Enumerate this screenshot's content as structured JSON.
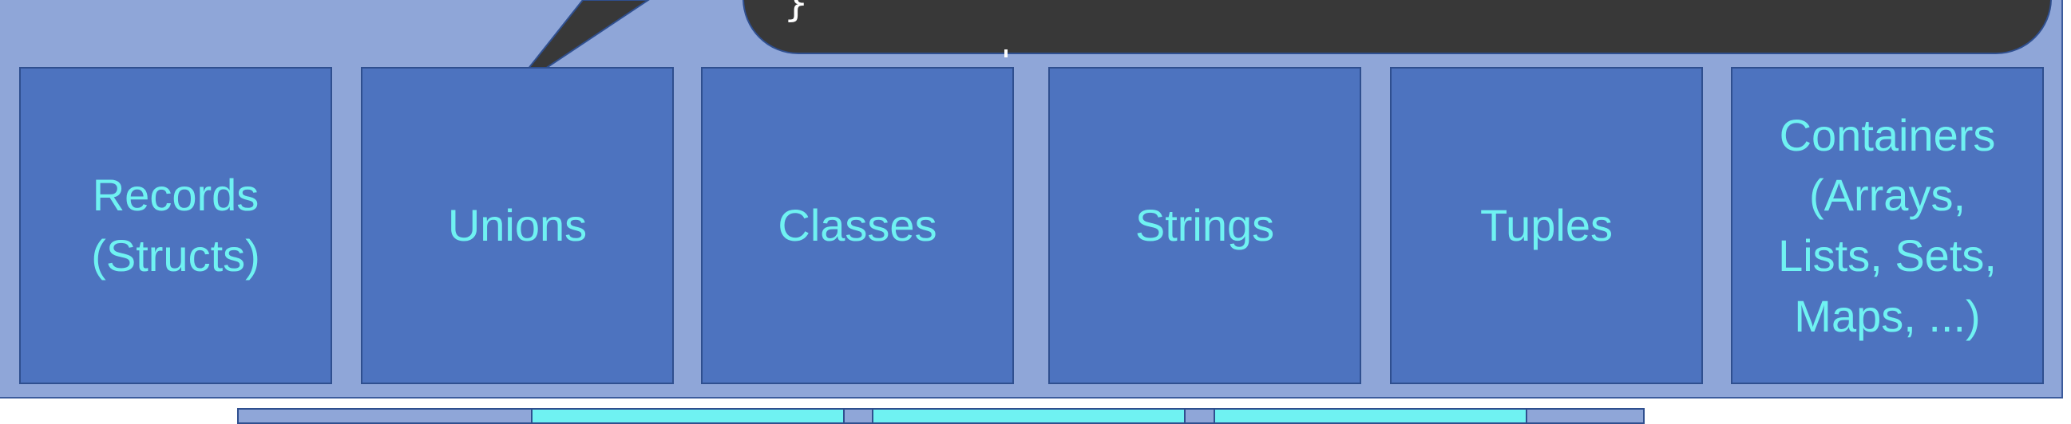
{
  "colors": {
    "band": "#8fa6d8",
    "box_fill": "#4d73bf",
    "box_text": "#6ff2f2",
    "border": "#2f4f8f",
    "callout": "#383838",
    "callout_text": "#ffffff"
  },
  "callout": {
    "code_fragment": "}"
  },
  "boxes": [
    {
      "label": "Records\n(Structs)"
    },
    {
      "label": "Unions"
    },
    {
      "label": "Classes"
    },
    {
      "label": "Strings"
    },
    {
      "label": "Tuples"
    },
    {
      "label": "Containers\n(Arrays,\nLists, Sets,\nMaps, ...)"
    }
  ]
}
